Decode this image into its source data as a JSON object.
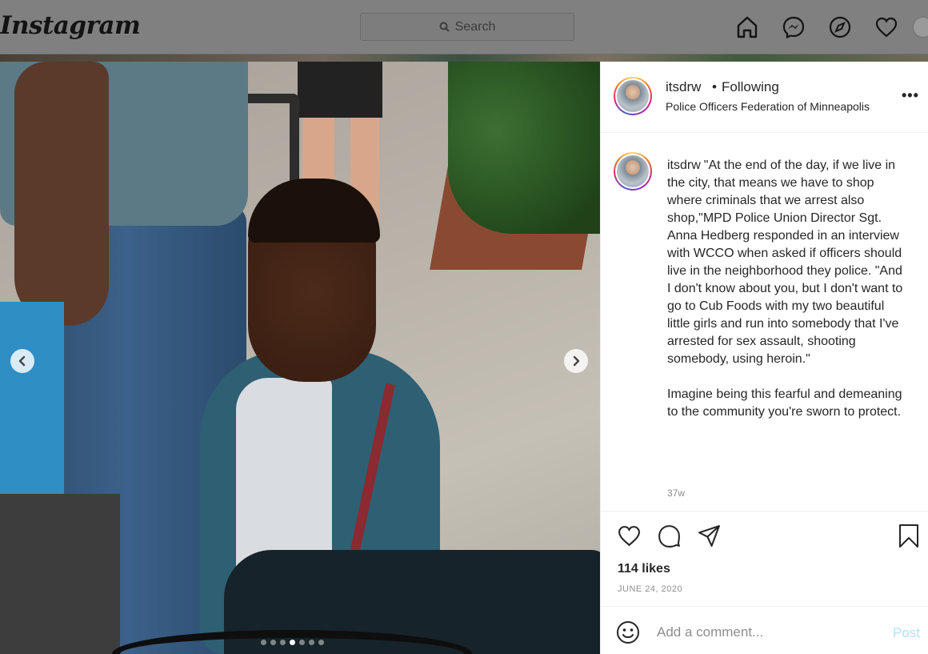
{
  "nav": {
    "logo": "Instagram",
    "search_placeholder": "Search",
    "icons": [
      "home-icon",
      "messenger-icon",
      "explore-icon",
      "activity-heart-icon",
      "profile-avatar"
    ]
  },
  "post": {
    "username": "itsdrw",
    "follow_status": "Following",
    "separator": "•",
    "location": "Police Officers Federation of Minneapolis",
    "more_label": "•••",
    "caption_user": "itsdrw",
    "caption_text": "\"At the end of the day, if we live in the city, that means we have to shop where criminals that we arrest also shop,\"MPD Police Union Director Sgt. Anna Hedberg responded in an interview with WCCO when asked if officers should live in the neighborhood they police. \"And I don't know about you, but I don't want to go to Cub Foods with my two beautiful little girls and run into somebody that I've arrested for sex assault, shooting somebody, using heroin.\"\n\nImagine being this fearful and demeaning to the community you're sworn to protect.",
    "time_ago": "37w",
    "likes": "114 likes",
    "date": "JUNE 24, 2020",
    "comment_placeholder": "Add a comment...",
    "post_label": "Post"
  },
  "carousel": {
    "slide_count": 7,
    "active_index": 3
  },
  "colors": {
    "post_link_disabled": "#b2dffc",
    "muted_text": "#8e8e8e",
    "dim_overlay": "#808080"
  }
}
